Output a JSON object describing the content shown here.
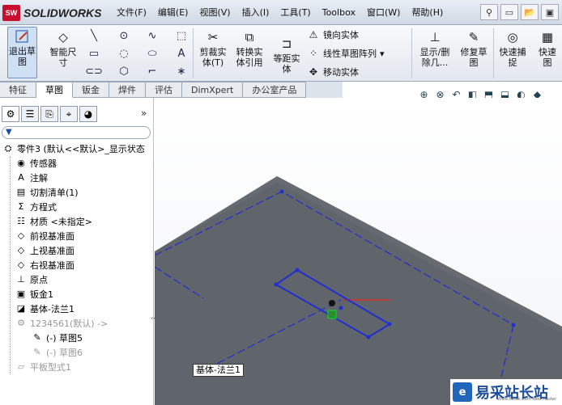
{
  "app": {
    "logo_badge": "SW",
    "logo_text": "SOLIDWORKS"
  },
  "menu": [
    "文件(F)",
    "编辑(E)",
    "视图(V)",
    "插入(I)",
    "工具(T)",
    "Toolbox",
    "窗口(W)",
    "帮助(H)"
  ],
  "ribbon": {
    "exit_sketch": "退出草\n图",
    "smart_dim": "智能尺\n寸",
    "trim": "剪裁实\n体(T)",
    "convert": "转换实\n体引用",
    "offset": "等距实\n体",
    "mirror": "镜向实体",
    "linear_pattern": "线性草图阵列",
    "move": "移动实体",
    "show_delete": "显示/删\n除几...",
    "repair": "修复草\n图",
    "quick_snap": "快速捕\n捉",
    "quick_view": "快速\n图"
  },
  "tabs": [
    "特征",
    "草图",
    "钣金",
    "焊件",
    "评估",
    "DimXpert",
    "办公室产品"
  ],
  "active_tab": "草图",
  "tree": [
    {
      "label": "零件3  (默认<<默认>_显示状态",
      "icon": "part-icon",
      "level": 0,
      "dim": false
    },
    {
      "label": "传感器",
      "icon": "sensor-icon",
      "level": 1,
      "dim": false
    },
    {
      "label": "注解",
      "icon": "annotation-icon",
      "level": 1,
      "dim": false
    },
    {
      "label": "切割清单(1)",
      "icon": "cut-list-icon",
      "level": 1,
      "dim": false
    },
    {
      "label": "方程式",
      "icon": "equation-icon",
      "level": 1,
      "dim": false
    },
    {
      "label": "材质 <未指定>",
      "icon": "material-icon",
      "level": 1,
      "dim": false
    },
    {
      "label": "前视基准面",
      "icon": "plane-icon",
      "level": 1,
      "dim": false
    },
    {
      "label": "上视基准面",
      "icon": "plane-icon",
      "level": 1,
      "dim": false
    },
    {
      "label": "右视基准面",
      "icon": "plane-icon",
      "level": 1,
      "dim": false
    },
    {
      "label": "原点",
      "icon": "origin-icon",
      "level": 1,
      "dim": false
    },
    {
      "label": "钣金1",
      "icon": "sheet-metal-icon",
      "level": 1,
      "dim": false
    },
    {
      "label": "基体-法兰1",
      "icon": "base-flange-icon",
      "level": 1,
      "dim": false
    },
    {
      "label": "1234561(默认) ->",
      "icon": "part-ref-icon",
      "level": 1,
      "dim": true
    },
    {
      "label": "(-) 草图5",
      "icon": "sketch-icon",
      "level": 2,
      "dim": false
    },
    {
      "label": "(-) 草图6",
      "icon": "sketch-icon",
      "level": 2,
      "dim": true
    },
    {
      "label": "平板型式1",
      "icon": "flat-pattern-icon",
      "level": 1,
      "dim": true
    }
  ],
  "viewport": {
    "callout": "基体-法兰1"
  },
  "watermark": {
    "badge": "e",
    "text": "易采站长站",
    "sub": "Www.Easck.Com  Web Master"
  }
}
